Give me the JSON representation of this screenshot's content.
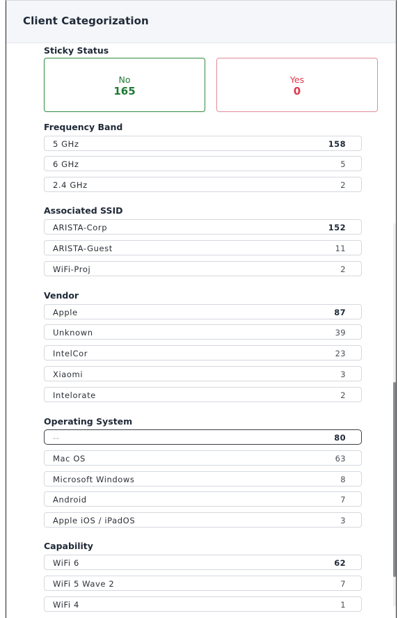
{
  "panel": {
    "title": "Client Categorization"
  },
  "sticky_status": {
    "title": "Sticky Status",
    "no": {
      "label": "No",
      "value": "165"
    },
    "yes": {
      "label": "Yes",
      "value": "0"
    }
  },
  "frequency_band": {
    "title": "Frequency Band",
    "items": [
      {
        "name": "5 GHz",
        "count": "158"
      },
      {
        "name": "6 GHz",
        "count": "5"
      },
      {
        "name": "2.4 GHz",
        "count": "2"
      }
    ]
  },
  "associated_ssid": {
    "title": "Associated SSID",
    "items": [
      {
        "name": "ARISTA-Corp",
        "count": "152"
      },
      {
        "name": "ARISTA-Guest",
        "count": "11"
      },
      {
        "name": "WiFi-Proj",
        "count": "2"
      }
    ]
  },
  "vendor": {
    "title": "Vendor",
    "items": [
      {
        "name": "Apple",
        "count": "87"
      },
      {
        "name": "Unknown",
        "count": "39"
      },
      {
        "name": "IntelCor",
        "count": "23"
      },
      {
        "name": "Xiaomi",
        "count": "3"
      },
      {
        "name": "Intelorate",
        "count": "2"
      }
    ]
  },
  "operating_system": {
    "title": "Operating System",
    "items": [
      {
        "name": "--",
        "count": "80"
      },
      {
        "name": "Mac OS",
        "count": "63"
      },
      {
        "name": "Microsoft Windows",
        "count": "8"
      },
      {
        "name": "Android",
        "count": "7"
      },
      {
        "name": "Apple iOS / iPadOS",
        "count": "3"
      }
    ]
  },
  "capability": {
    "title": "Capability",
    "items": [
      {
        "name": "WiFi 6",
        "count": "62"
      },
      {
        "name": "WiFi 5 Wave 2",
        "count": "7"
      },
      {
        "name": "WiFi 4",
        "count": "1"
      }
    ]
  },
  "colors": {
    "sticky_no": "#1e7a33",
    "sticky_yes": "#e0364d"
  }
}
